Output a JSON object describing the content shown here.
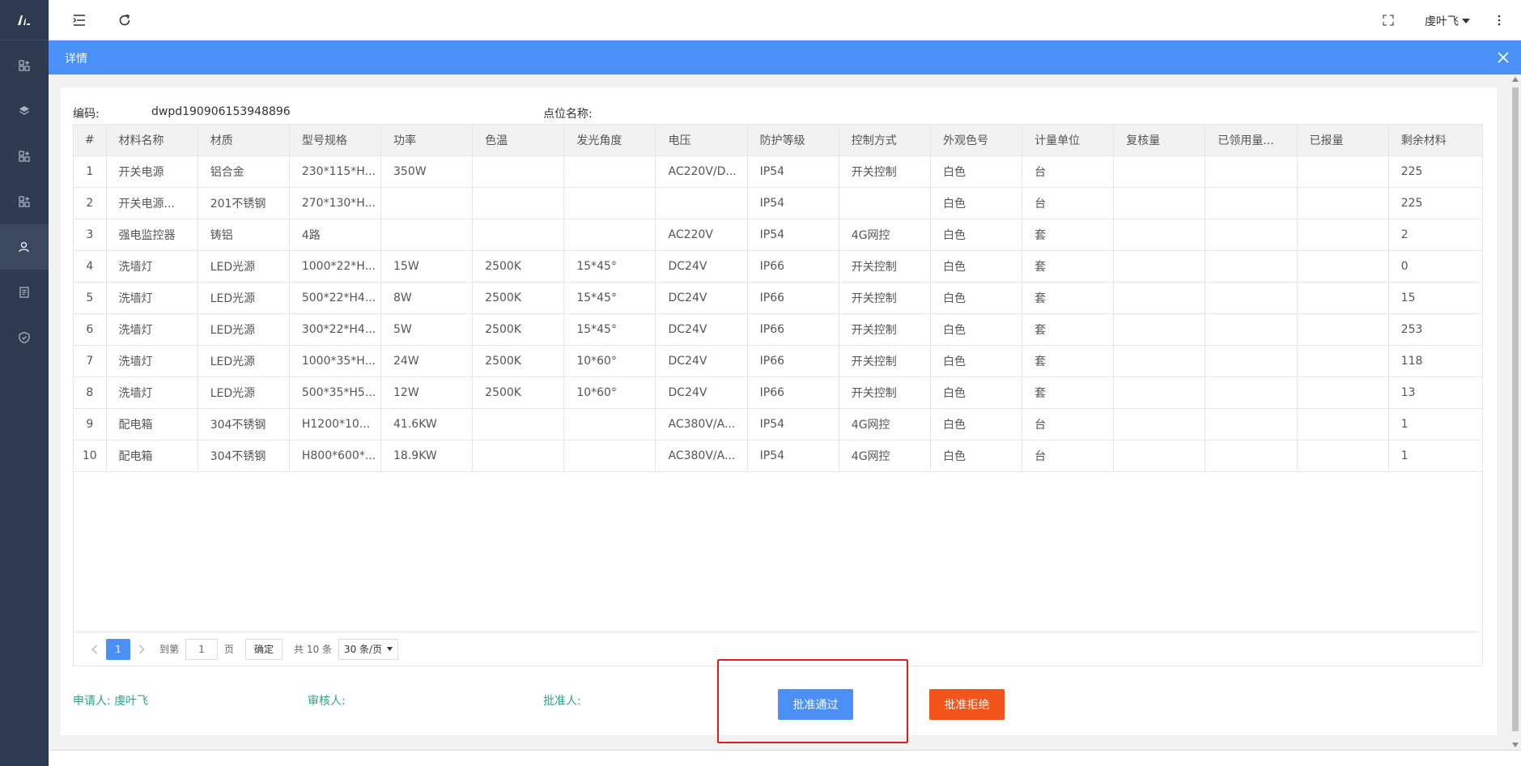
{
  "header": {
    "user_name": "虔叶飞"
  },
  "dialog": {
    "title": "详情"
  },
  "info": {
    "code_label": "编码:",
    "code_value": "dwpd190906153948896",
    "point_label": "点位名称:",
    "point_value": ""
  },
  "table": {
    "columns": [
      "#",
      "材料名称",
      "材质",
      "型号规格",
      "功率",
      "色温",
      "发光角度",
      "电压",
      "防护等级",
      "控制方式",
      "外观色号",
      "计量单位",
      "复核量",
      "已领用量...",
      "已报量",
      "剩余材料"
    ],
    "rows": [
      [
        "1",
        "开关电源",
        "铝合金",
        "230*115*H...",
        "350W",
        "",
        "",
        "AC220V/D...",
        "IP54",
        "开关控制",
        "白色",
        "台",
        "",
        "",
        "",
        "225"
      ],
      [
        "2",
        "开关电源...",
        "201不锈钢",
        "270*130*H...",
        "",
        "",
        "",
        "",
        "IP54",
        "",
        "白色",
        "台",
        "",
        "",
        "",
        "225"
      ],
      [
        "3",
        "强电监控器",
        "铸铝",
        "4路",
        "",
        "",
        "",
        "AC220V",
        "IP54",
        "4G网控",
        "白色",
        "套",
        "",
        "",
        "",
        "2"
      ],
      [
        "4",
        "洗墙灯",
        "LED光源",
        "1000*22*H...",
        "15W",
        "2500K",
        "15*45°",
        "DC24V",
        "IP66",
        "开关控制",
        "白色",
        "套",
        "",
        "",
        "",
        "0"
      ],
      [
        "5",
        "洗墙灯",
        "LED光源",
        "500*22*H4...",
        "8W",
        "2500K",
        "15*45°",
        "DC24V",
        "IP66",
        "开关控制",
        "白色",
        "套",
        "",
        "",
        "",
        "15"
      ],
      [
        "6",
        "洗墙灯",
        "LED光源",
        "300*22*H4...",
        "5W",
        "2500K",
        "15*45°",
        "DC24V",
        "IP66",
        "开关控制",
        "白色",
        "套",
        "",
        "",
        "",
        "253"
      ],
      [
        "7",
        "洗墙灯",
        "LED光源",
        "1000*35*H...",
        "24W",
        "2500K",
        "10*60°",
        "DC24V",
        "IP66",
        "开关控制",
        "白色",
        "套",
        "",
        "",
        "",
        "118"
      ],
      [
        "8",
        "洗墙灯",
        "LED光源",
        "500*35*H5...",
        "12W",
        "2500K",
        "10*60°",
        "DC24V",
        "IP66",
        "开关控制",
        "白色",
        "套",
        "",
        "",
        "",
        "13"
      ],
      [
        "9",
        "配电箱",
        "304不锈钢",
        "H1200*10...",
        "41.6KW",
        "",
        "",
        "AC380V/A...",
        "IP54",
        "4G网控",
        "白色",
        "台",
        "",
        "",
        "",
        "1"
      ],
      [
        "10",
        "配电箱",
        "304不锈钢",
        "H800*600*...",
        "18.9KW",
        "",
        "",
        "AC380V/A...",
        "IP54",
        "4G网控",
        "白色",
        "台",
        "",
        "",
        "",
        "1"
      ]
    ]
  },
  "pager": {
    "current_page": "1",
    "goto_label": "到第",
    "goto_value": "1",
    "page_unit": "页",
    "confirm_label": "确定",
    "total_label": "共 10 条",
    "page_size": "30 条/页"
  },
  "signatures": {
    "applicant": "申请人: 虔叶飞",
    "reviewer": "审核人:",
    "approver": "批准人:"
  },
  "actions": {
    "approve_label": "批准通过",
    "reject_label": "批准拒绝"
  },
  "colors": {
    "sidebar": "#2e3a4f",
    "accent": "#4a90f7",
    "reject": "#f2541b",
    "signature": "#2aa58a",
    "highlight": "#e02020"
  }
}
